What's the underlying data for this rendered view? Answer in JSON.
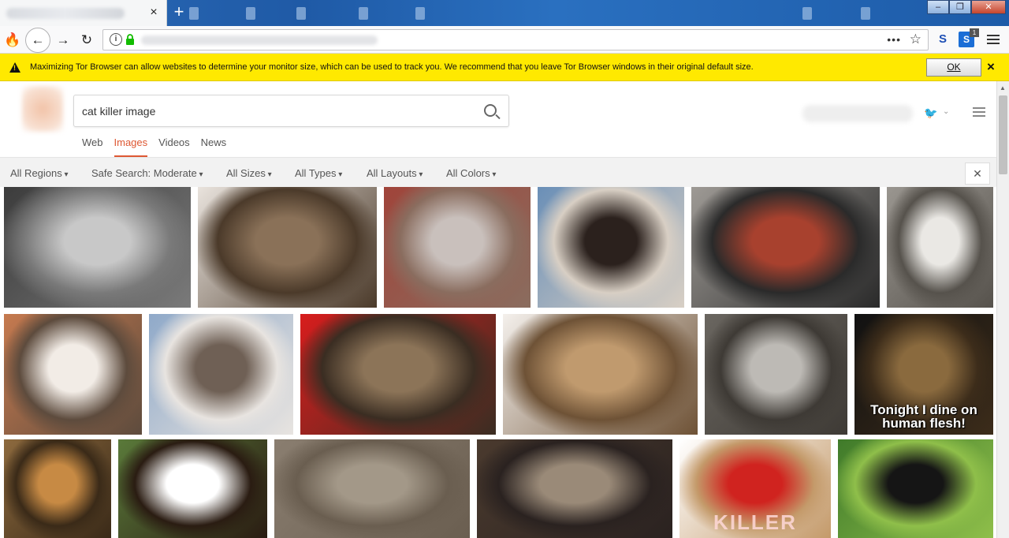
{
  "browser": {
    "tab_close_glyph": "×",
    "new_tab_glyph": "+",
    "window_controls": [
      "–",
      "❐",
      "✕"
    ],
    "nav": {
      "back": "←",
      "forward": "→",
      "reload": "↻",
      "identity": "🔥"
    },
    "url_info": "i",
    "url_more": "•••",
    "url_star": "☆",
    "ext_s": "S",
    "ext_box": "S",
    "ext_box_badge": "1"
  },
  "notification": {
    "text": "Maximizing Tor Browser can allow websites to determine your monitor size, which can be used to track you. We recommend that you leave Tor Browser windows in their original default size.",
    "ok_label": "OK",
    "close_glyph": "×",
    "color": "#ffe900"
  },
  "search": {
    "query": "cat killer image",
    "twitter_glyph": "🐦",
    "twitter_chev": "⌄"
  },
  "vertical_tabs": [
    {
      "label": "Web",
      "active": false
    },
    {
      "label": "Images",
      "active": true
    },
    {
      "label": "Videos",
      "active": false
    },
    {
      "label": "News",
      "active": false
    }
  ],
  "filters": [
    "All Regions",
    "Safe Search: Moderate",
    "All Sizes",
    "All Types",
    "All Layouts",
    "All Colors"
  ],
  "filter_close": "✕",
  "accent_color": "#de5833",
  "images": [
    {
      "row": 0,
      "colors": [
        "#3c3c3c",
        "#c8c8c8",
        "#7a7a7a"
      ],
      "caption": "",
      "stamp": ""
    },
    {
      "row": 0,
      "colors": [
        "#e9e3dd",
        "#8a7158",
        "#4b3a2a"
      ],
      "caption": "",
      "stamp": ""
    },
    {
      "row": 0,
      "colors": [
        "#a0443a",
        "#c9c0bc",
        "#8a6d5f"
      ],
      "caption": "",
      "stamp": ""
    },
    {
      "row": 0,
      "colors": [
        "#6a8fb7",
        "#2b211d",
        "#d8cfc4"
      ],
      "caption": "",
      "stamp": ""
    },
    {
      "row": 0,
      "colors": [
        "#9e9a95",
        "#a8412e",
        "#2a2a2a"
      ],
      "caption": "",
      "stamp": ""
    },
    {
      "row": 0,
      "colors": [
        "#9a9690",
        "#eae8e4",
        "#56524c"
      ],
      "caption": "",
      "stamp": ""
    },
    {
      "row": 1,
      "colors": [
        "#c67a4f",
        "#f2ece6",
        "#5d4b3d"
      ],
      "caption": "",
      "stamp": ""
    },
    {
      "row": 1,
      "colors": [
        "#8fa9c9",
        "#6f6055",
        "#e8e4e0"
      ],
      "caption": "",
      "stamp": ""
    },
    {
      "row": 1,
      "colors": [
        "#d81d1d",
        "#8c7458",
        "#3a2d22"
      ],
      "caption": "",
      "stamp": ""
    },
    {
      "row": 1,
      "colors": [
        "#f4f0ec",
        "#c09a6e",
        "#6e5236"
      ],
      "caption": "",
      "stamp": ""
    },
    {
      "row": 1,
      "colors": [
        "#6a6660",
        "#bdbab5",
        "#3e3a35"
      ],
      "caption": "",
      "stamp": ""
    },
    {
      "row": 1,
      "colors": [
        "#111111",
        "#8a6a3e",
        "#3c2c1a"
      ],
      "caption": "Tonight I dine on human flesh!",
      "stamp": ""
    },
    {
      "row": 2,
      "colors": [
        "#8d6a3e",
        "#c78a44",
        "#3a2a18"
      ],
      "caption": "",
      "stamp": ""
    },
    {
      "row": 2,
      "colors": [
        "#5a7a3a",
        "#ffffff",
        "#2a1c12"
      ],
      "caption": "",
      "stamp": ""
    },
    {
      "row": 2,
      "colors": [
        "#8a7e70",
        "#a39888",
        "#6a5e50"
      ],
      "caption": "",
      "stamp": ""
    },
    {
      "row": 2,
      "colors": [
        "#4a3a2e",
        "#9a8a78",
        "#2a2220"
      ],
      "caption": "",
      "stamp": ""
    },
    {
      "row": 2,
      "colors": [
        "#ffffff",
        "#d0231f",
        "#c49a6a"
      ],
      "caption": "",
      "stamp": "KILLER"
    },
    {
      "row": 2,
      "colors": [
        "#3f7a2a",
        "#151515",
        "#8fbf4a"
      ],
      "caption": "",
      "stamp": ""
    }
  ]
}
